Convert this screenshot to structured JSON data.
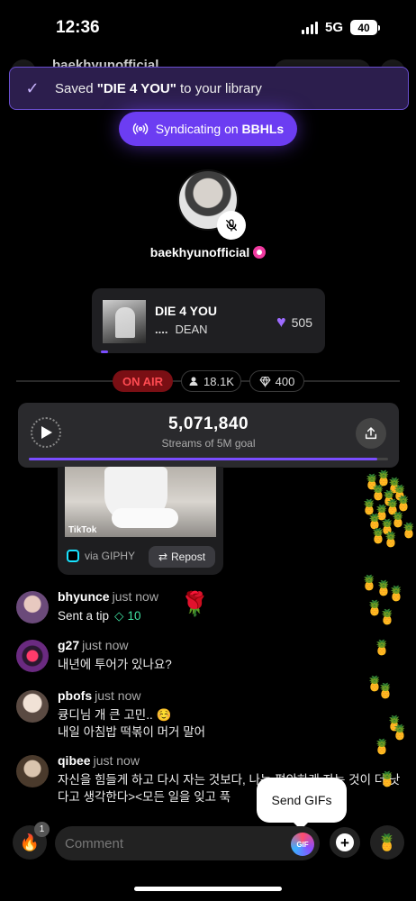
{
  "status_bar": {
    "time": "12:36",
    "network": "5G",
    "battery": "40"
  },
  "header_behind": {
    "username": "baekhyunofficial"
  },
  "toast": {
    "prefix": "Saved ",
    "song": "\"DIE 4 YOU\"",
    "suffix": " to your library"
  },
  "syndicate": {
    "label": "Syndicating on ",
    "network": "BBHLs"
  },
  "host": {
    "name": "baekhyunofficial"
  },
  "now_playing": {
    "title": "DIE 4 YOU",
    "artist": "DEAN",
    "dots": "....",
    "likes": "505"
  },
  "live": {
    "on_air": "ON AIR",
    "listeners": "18.1K",
    "gems": "400"
  },
  "streams": {
    "count": "5,071,840",
    "goal": "Streams of 5M goal",
    "progress": 0.97
  },
  "gif_card": {
    "watermark": "TikTok",
    "source": "via GIPHY",
    "repost": "Repost"
  },
  "comments": [
    {
      "user": "bhyunce",
      "time": "just now",
      "text": "Sent a tip",
      "tip": "10"
    },
    {
      "user": "g27",
      "time": "just now",
      "text": "내년에 투어가 있나요?"
    },
    {
      "user": "pbofs",
      "time": "just now",
      "line1": "큥디님 개 큰 고민.. ☺️",
      "line2": "내일 아침밥 떡볶이 머거 말어"
    },
    {
      "user": "qibee",
      "time": "just now",
      "text": "자신을 힘들게 하고 다시 자는 것보다, 나는 편안하게 자는 것이 더 낫다고 생각한다><모든 일을 잊고 푹"
    }
  ],
  "composer": {
    "placeholder": "Comment",
    "fire_count": "1",
    "gif_label": "GIF"
  },
  "tooltip": {
    "text": "Send GIFs"
  },
  "icons": {
    "check": "check-icon",
    "broadcast": "broadcast-icon",
    "mute": "mic-off-icon",
    "heart": "heart-icon",
    "person": "person-icon",
    "gem": "gem-icon",
    "play": "play-icon",
    "share": "share-icon",
    "repost": "repost-icon",
    "fire": "fire-icon",
    "plus": "plus-icon",
    "pineapple": "pineapple-icon",
    "rose": "rose-icon"
  },
  "colors": {
    "accent": "#6c3df2",
    "on_air": "#ff4b52",
    "tip": "#3fe0a0",
    "heart": "#9d6bff"
  }
}
